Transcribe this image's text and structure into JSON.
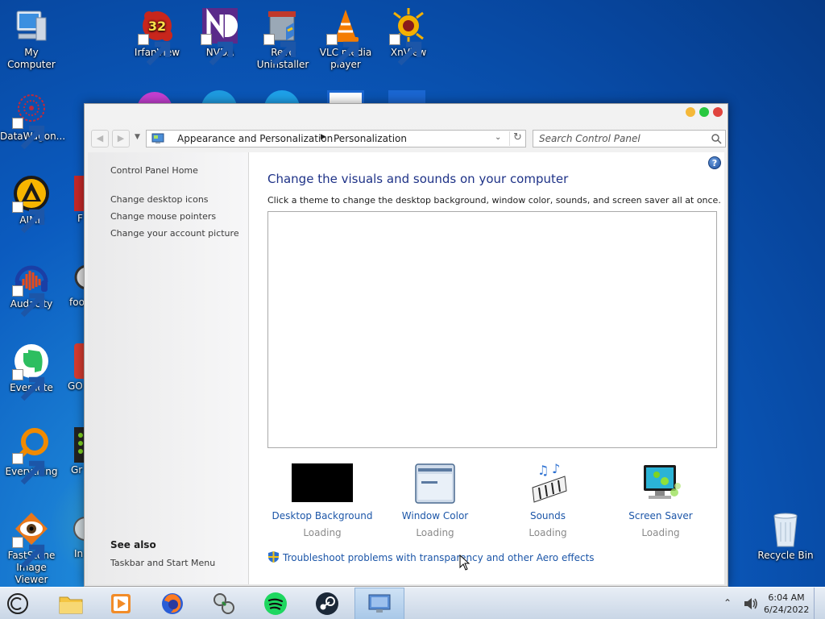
{
  "desktop": {
    "icons": [
      {
        "name": "my-computer",
        "label": "My Computer"
      },
      {
        "name": "irfanview",
        "label": "IrfanView",
        "badge": "32"
      },
      {
        "name": "nvda",
        "label": "NVDA"
      },
      {
        "name": "revo-uninstaller",
        "label": "Revo Uninstaller"
      },
      {
        "name": "vlc",
        "label": "VLC media player"
      },
      {
        "name": "xnview",
        "label": "XnView"
      },
      {
        "name": "datawagon",
        "label": "DataWagon..."
      },
      {
        "name": "aimp",
        "label": "AIMP"
      },
      {
        "name": "audacity",
        "label": "Audacity"
      },
      {
        "name": "evernote",
        "label": "Evernote"
      },
      {
        "name": "everything",
        "label": "Everything"
      },
      {
        "name": "faststone",
        "label": "FastStone Image Viewer"
      },
      {
        "name": "recycle-bin",
        "label": "Recycle Bin"
      },
      {
        "name": "partial-f",
        "label": "F"
      },
      {
        "name": "partial-foo",
        "label": "foo"
      },
      {
        "name": "partial-gol",
        "label": "GO"
      },
      {
        "name": "partial-gr",
        "label": "Gr"
      },
      {
        "name": "partial-in",
        "label": "In"
      }
    ]
  },
  "window": {
    "address": {
      "crumbs": [
        "Appearance and Personalization",
        "Personalization"
      ]
    },
    "search": {
      "placeholder": "Search Control Panel"
    },
    "sidebar": {
      "home": "Control Panel Home",
      "links": [
        "Change desktop icons",
        "Change mouse pointers",
        "Change your account picture"
      ],
      "see_also_heading": "See also",
      "see_also_links": [
        "Taskbar and Start Menu"
      ]
    },
    "content": {
      "heading": "Change the visuals and sounds on your computer",
      "subtext": "Click a theme to change the desktop background, window color, sounds, and screen saver all at once.",
      "options": [
        {
          "label": "Desktop Background",
          "status": "Loading"
        },
        {
          "label": "Window Color",
          "status": "Loading"
        },
        {
          "label": "Sounds",
          "status": "Loading"
        },
        {
          "label": "Screen Saver",
          "status": "Loading"
        }
      ],
      "troubleshoot_link": "Troubleshoot problems with transparency and other Aero effects",
      "help_glyph": "?"
    }
  },
  "taskbar": {
    "apps": [
      "start-button",
      "file-explorer",
      "media-player",
      "firefox",
      "network-app",
      "spotify",
      "steam",
      "control-panel"
    ],
    "clock": {
      "time": "6:04 AM",
      "date": "6/24/2022"
    }
  },
  "colors": {
    "link": "#1c56a8",
    "heading": "#1e3287",
    "window_close": "#e0443e",
    "window_max": "#28c840",
    "window_min": "#f5b839"
  }
}
